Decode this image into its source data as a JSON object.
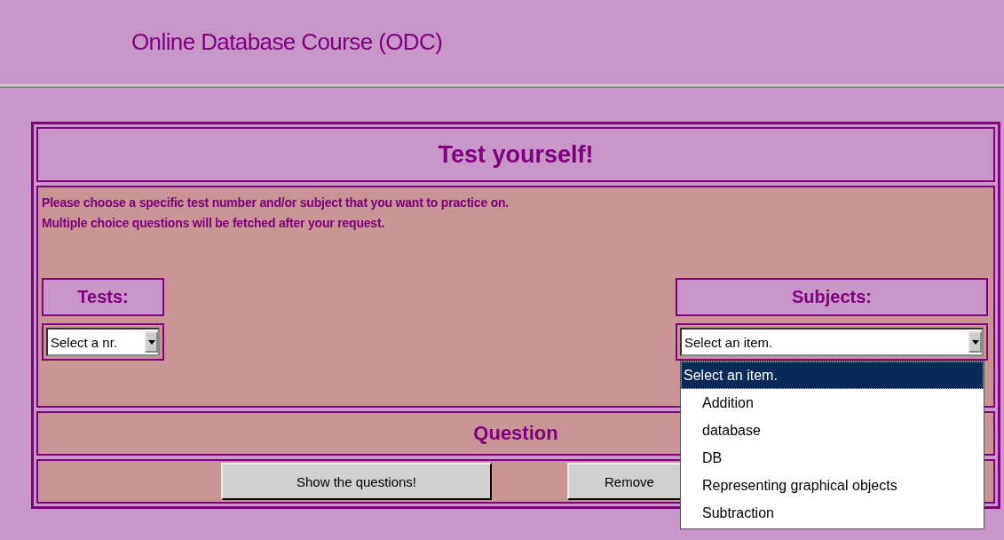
{
  "header": {
    "title": "Online Database Course (ODC)"
  },
  "panel": {
    "title": "Test yourself!",
    "instructions": [
      "Please choose a specific test number and/or subject that you want to practice on.",
      "Multiple choice questions will be fetched after your request."
    ],
    "tests": {
      "label": "Tests:",
      "value": "Select a nr."
    },
    "subjects": {
      "label": "Subjects:",
      "value": "Select an item.",
      "expanded": true,
      "options": [
        {
          "label": "Select an item.",
          "selected": true
        },
        {
          "label": "Addition",
          "selected": false
        },
        {
          "label": "database",
          "selected": false
        },
        {
          "label": "DB",
          "selected": false
        },
        {
          "label": "Representing graphical objects",
          "selected": false
        },
        {
          "label": "Subtraction",
          "selected": false
        }
      ]
    },
    "question_heading": "Question",
    "buttons": [
      "Show the questions!",
      "Remove"
    ]
  }
}
